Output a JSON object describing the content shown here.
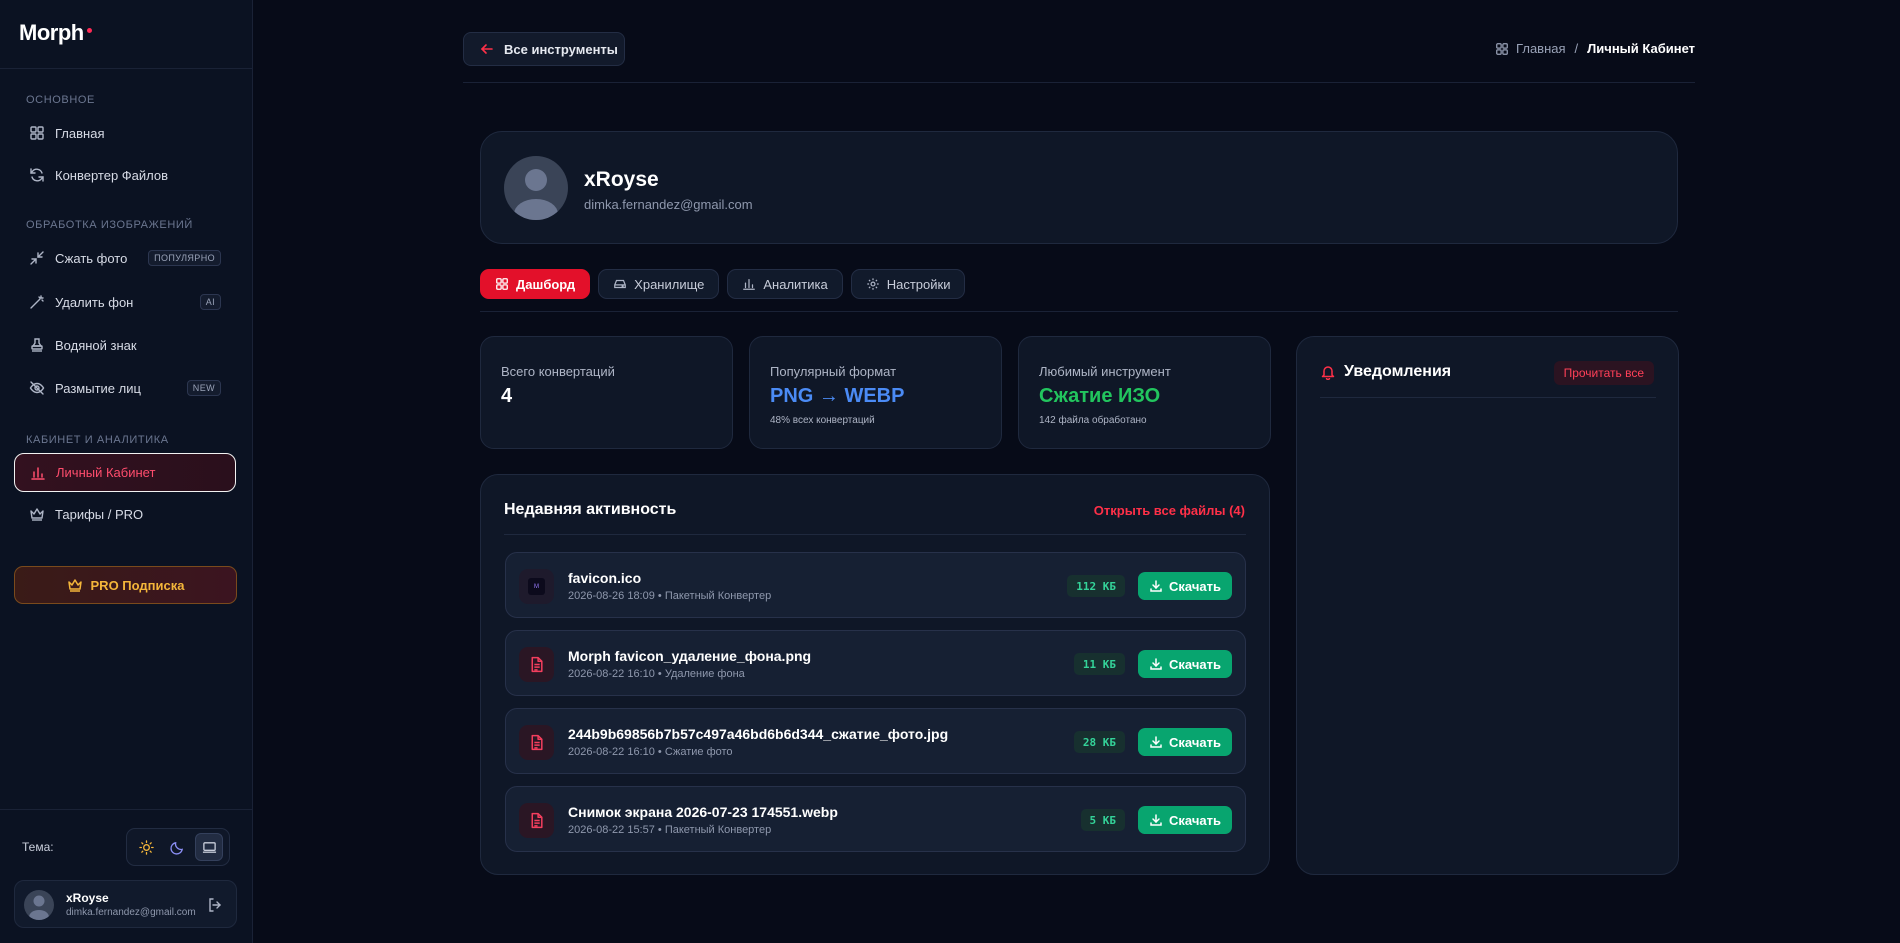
{
  "brand": {
    "name": "Morph",
    "accent": "#ff2a55"
  },
  "sidebar": {
    "sections": [
      {
        "label": "Основное"
      },
      {
        "label": "Обработка изображений"
      },
      {
        "label": "Кабинет и аналитика"
      }
    ],
    "items": [
      {
        "label": "Главная",
        "icon": "grid-icon"
      },
      {
        "label": "Конвертер Файлов",
        "icon": "refresh-icon"
      },
      {
        "label": "Сжать фото",
        "icon": "compress-icon",
        "badge": "ПОПУЛЯРНО"
      },
      {
        "label": "Удалить фон",
        "icon": "magic-wand-icon",
        "badge": "AI"
      },
      {
        "label": "Водяной знак",
        "icon": "stamp-icon"
      },
      {
        "label": "Размытие лиц",
        "icon": "eye-off-icon",
        "badge": "NEW"
      },
      {
        "label": "Личный Кабинет",
        "icon": "bar-chart-icon",
        "active": true
      },
      {
        "label": "Тарифы / PRO",
        "icon": "crown-icon"
      }
    ],
    "pro_button": "PRO Подписка",
    "theme": {
      "label": "Тема:",
      "options": [
        "sun-icon",
        "moon-icon",
        "monitor-icon"
      ],
      "selected": "monitor-icon"
    },
    "user": {
      "name": "xRoyse",
      "email": "dimka.fernandez@gmail.com"
    }
  },
  "header": {
    "back_label": "Все инструменты",
    "breadcrumb": {
      "home": "Главная",
      "separator": "/",
      "current": "Личный Кабинет"
    }
  },
  "profile": {
    "name": "xRoyse",
    "email": "dimka.fernandez@gmail.com"
  },
  "tabs": [
    {
      "label": "Дашборд",
      "icon": "grid-icon",
      "active": true
    },
    {
      "label": "Хранилище",
      "icon": "drive-icon"
    },
    {
      "label": "Аналитика",
      "icon": "bar-chart-icon"
    },
    {
      "label": "Настройки",
      "icon": "gear-icon"
    }
  ],
  "stats": [
    {
      "label": "Всего конвертаций",
      "value": "4",
      "sub": "",
      "color": "#ffffff"
    },
    {
      "label": "Популярный формат",
      "value": "PNG → WEBP",
      "sub": "48% всех конвертаций",
      "color": "#4b8bf5"
    },
    {
      "label": "Любимый инструмент",
      "value": "Сжатие ИЗО",
      "sub": "142 файла обработано",
      "color": "#22c55e"
    }
  ],
  "activity": {
    "title": "Недавняя активность",
    "open_all": "Открыть все файлы (4)",
    "download_label": "Скачать",
    "files": [
      {
        "name": "favicon.ico",
        "meta": "2026-08-26 18:09 • Пакетный Конвертер",
        "size": "112 КБ"
      },
      {
        "name": "Morph favicon_удаление_фона.png",
        "meta": "2026-08-22 16:10 • Удаление фона",
        "size": "11 КБ"
      },
      {
        "name": "244b9b69856b7b57c497a46bd6b6d344_сжатие_фото.jpg",
        "meta": "2026-08-22 16:10 • Сжатие фото",
        "size": "28 КБ"
      },
      {
        "name": "Снимок экрана 2026-07-23 174551.webp",
        "meta": "2026-08-22 15:57 • Пакетный Конвертер",
        "size": "5 КБ"
      }
    ]
  },
  "notifications": {
    "title": "Уведомления",
    "read_all": "Прочитать все"
  }
}
